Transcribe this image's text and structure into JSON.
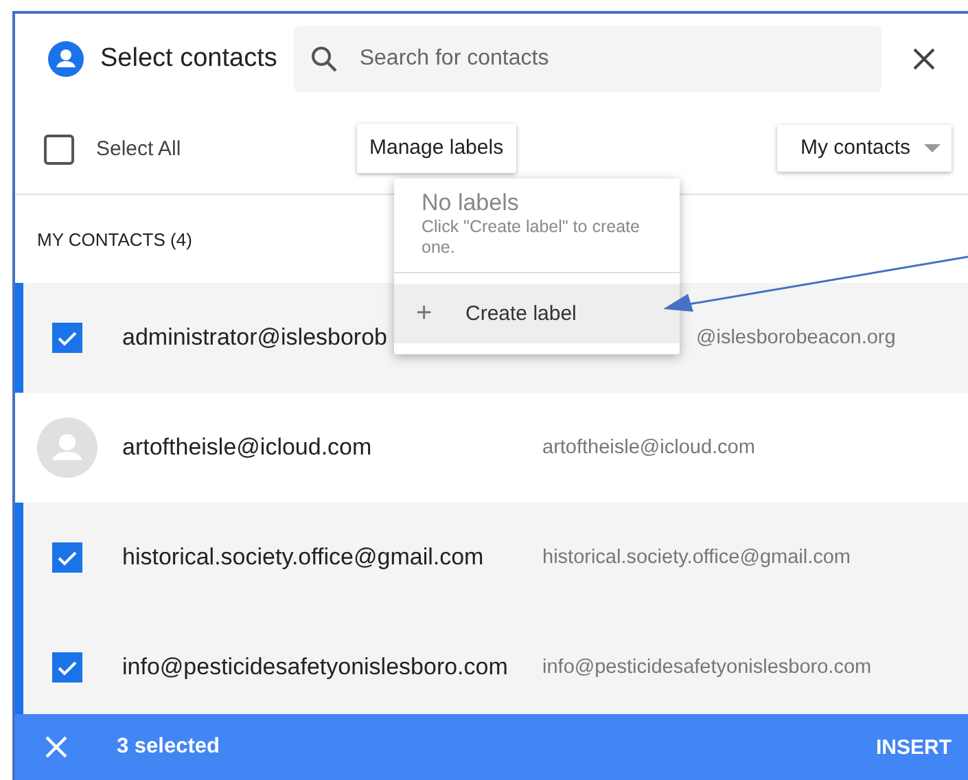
{
  "header": {
    "title": "Select contacts",
    "search": {
      "placeholder": "Search for contacts"
    }
  },
  "toolbar": {
    "select_all": {
      "label": "Select All",
      "checked": false
    },
    "manage_labels": "Manage labels",
    "filter": "My contacts"
  },
  "section_heading": "MY CONTACTS (4)",
  "contacts": [
    {
      "name": "administrator@islesborob",
      "email": "@islesborobeacon.org",
      "selected": true
    },
    {
      "name": "artoftheisle@icloud.com",
      "email": "artoftheisle@icloud.com",
      "selected": false
    },
    {
      "name": "historical.society.office@gmail.com",
      "email": "historical.society.office@gmail.com",
      "selected": true
    },
    {
      "name": "info@pesticidesafetyonislesboro.com",
      "email": "info@pesticidesafetyonislesboro.com",
      "selected": true
    }
  ],
  "labels_menu": {
    "title": "No labels",
    "hint": "Click \"Create label\" to create one.",
    "items": [
      {
        "icon": "+",
        "label": "Create label",
        "highlighted": true
      }
    ]
  },
  "selection_bar": {
    "count": "3 selected",
    "action": "INSERT"
  }
}
